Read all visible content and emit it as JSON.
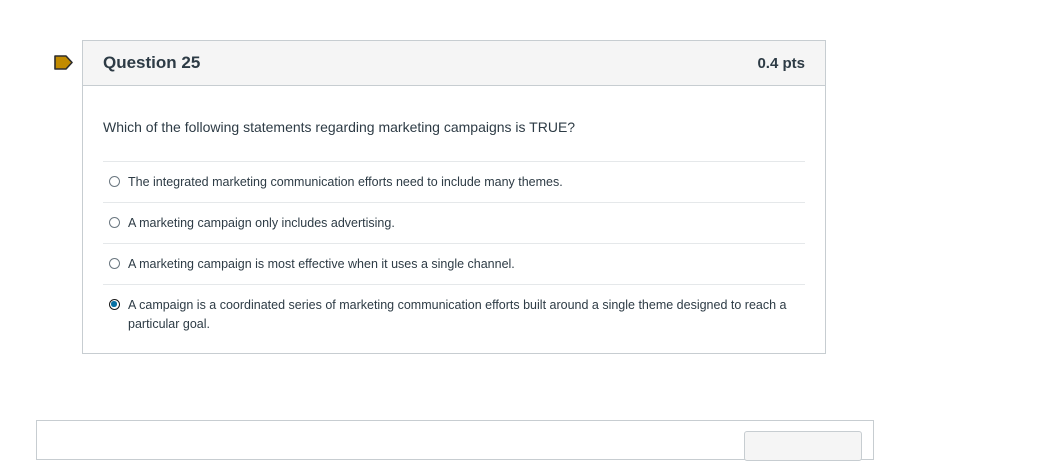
{
  "question": {
    "title": "Question 25",
    "points": "0.4 pts",
    "flag_color": "#c28b00",
    "text": "Which of the following statements regarding marketing campaigns is TRUE?",
    "answers": [
      {
        "label": "The integrated marketing communication efforts need to include many themes.",
        "selected": false
      },
      {
        "label": "A marketing campaign only includes advertising.",
        "selected": false
      },
      {
        "label": "A marketing campaign is most effective when it uses a single channel.",
        "selected": false
      },
      {
        "label": "A campaign is a coordinated series of marketing communication efforts built around a single theme designed to reach a particular goal.",
        "selected": true
      }
    ]
  }
}
